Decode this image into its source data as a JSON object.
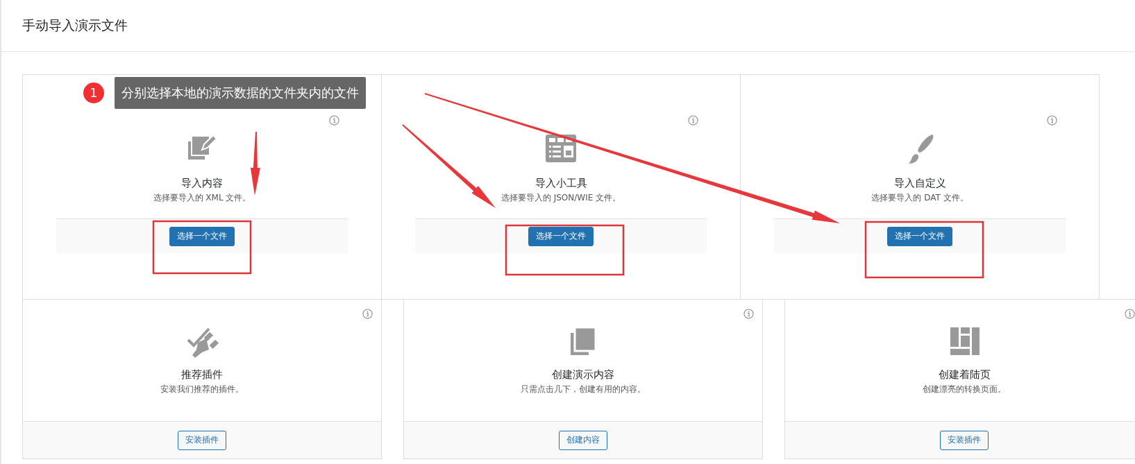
{
  "page_title": "手动导入演示文件",
  "import_cards": [
    {
      "title": "导入内容",
      "description": "选择要导入的 XML 文件。",
      "button": {
        "label": "选择一个文件",
        "kind": "primary"
      }
    },
    {
      "title": "导入小工具",
      "description": "选择要导入的 JSON/WIE 文件。",
      "button": {
        "label": "选择一个文件",
        "kind": "primary"
      }
    },
    {
      "title": "导入自定义",
      "description": "选择要导入的 DAT 文件。",
      "button": {
        "label": "选择一个文件",
        "kind": "primary"
      }
    }
  ],
  "action_cards": [
    {
      "title": "推荐插件",
      "description": "安装我们推荐的插件。",
      "button": {
        "label": "安装插件",
        "kind": "secondary"
      }
    },
    {
      "title": "创建演示内容",
      "description": "只需点击几下，创建有用的内容。",
      "button": {
        "label": "创建内容",
        "kind": "secondary"
      }
    },
    {
      "title": "创建着陆页",
      "description": "创建漂亮的转换页面。",
      "button": {
        "label": "安装插件",
        "kind": "secondary"
      }
    }
  ],
  "callout": {
    "step": "1",
    "text": "分别选择本地的演示数据的文件夹内的文件"
  }
}
